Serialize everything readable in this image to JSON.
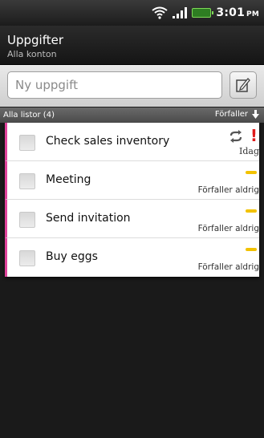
{
  "status_bar": {
    "time": "3:01",
    "ampm": "PM",
    "icons": [
      "wifi-icon",
      "signal-icon",
      "battery-icon"
    ]
  },
  "header": {
    "title": "Uppgifter",
    "subtitle": "Alla konton"
  },
  "new_task": {
    "placeholder": "Ny uppgift",
    "edit_icon": "edit-icon"
  },
  "list_header": {
    "left_label": "Alla listor (4)",
    "sort_label": "Förfaller",
    "sort_icon": "arrow-down-icon"
  },
  "tasks": [
    {
      "title": "Check sales inventory",
      "due": "Idag",
      "priority": "high",
      "repeat": true
    },
    {
      "title": "Meeting",
      "due": "Förfaller aldrig",
      "priority": "normal",
      "repeat": false
    },
    {
      "title": "Send invitation",
      "due": "Förfaller aldrig",
      "priority": "normal",
      "repeat": false
    },
    {
      "title": "Buy eggs",
      "due": "Förfaller aldrig",
      "priority": "normal",
      "repeat": false
    }
  ],
  "colors": {
    "list_accent": "#e0429b",
    "priority_high": "#e01a1a",
    "priority_normal": "#f2c200"
  }
}
